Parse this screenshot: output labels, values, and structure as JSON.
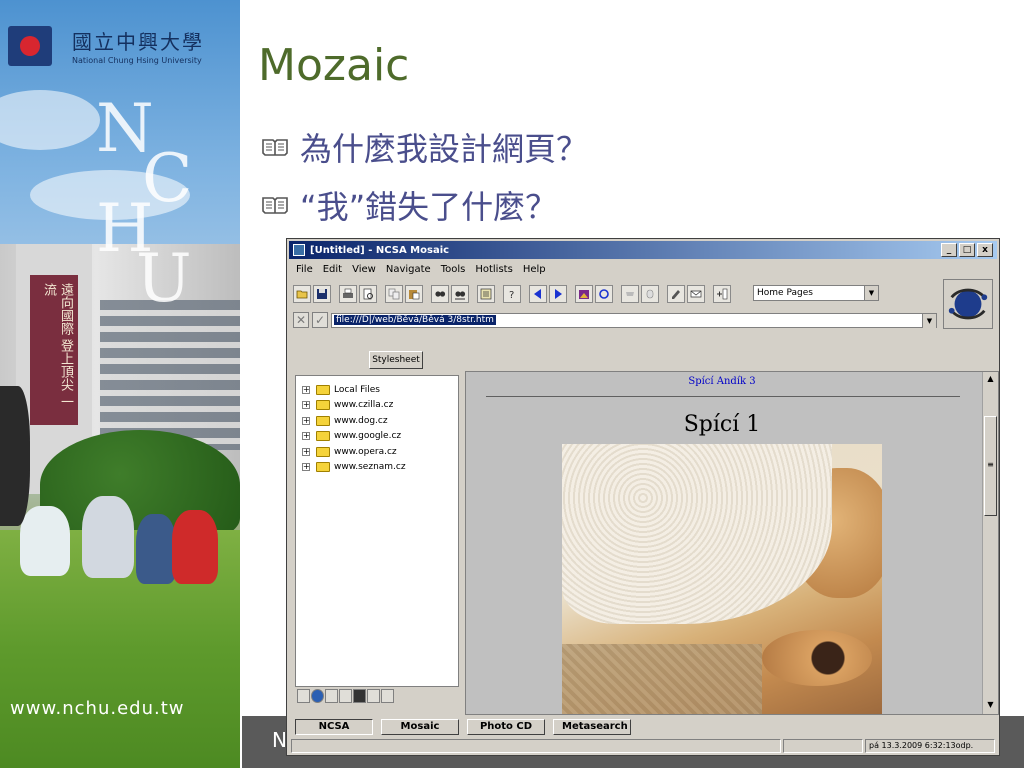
{
  "sidebar": {
    "logo_zh": "國立中興大學",
    "logo_en": "National Chung Hsing University",
    "monogram": [
      "N",
      "C",
      "H",
      "U"
    ],
    "banner_text": "遠向國際 登上頂尖 一流",
    "url": "www.nchu.edu.tw"
  },
  "slide": {
    "title": "Mozaic",
    "bullets": [
      {
        "icon": "book-icon",
        "text": "為什麼我設計網頁？"
      },
      {
        "icon": "book-icon",
        "text": "“我”錯失了什麼？"
      }
    ],
    "footer_letter": "N"
  },
  "browser": {
    "window_title": "[Untitled] - NCSA Mosaic",
    "title_buttons": [
      "_",
      "□",
      "x"
    ],
    "menu": [
      "File",
      "Edit",
      "View",
      "Navigate",
      "Tools",
      "Hotlists",
      "Help"
    ],
    "toolbar_icons": [
      "open-icon",
      "save-icon",
      "print-icon",
      "print-preview-icon",
      "copy-icon",
      "paste-icon",
      "find-icon",
      "find-next-icon",
      "document-icon",
      "help-icon",
      "back-icon",
      "forward-icon",
      "home-icon",
      "reload-icon",
      "stop-icon",
      "hand-icon",
      "annotate-icon",
      "mail-icon",
      "add-hotlist-icon"
    ],
    "hotlist_combo": "Home Pages",
    "url_value": "file:///D|/web/Běvá/Běvá 3/8str.htm",
    "stylesheet_button": "Stylesheet",
    "tree": [
      "Local Files",
      "www.czilla.cz",
      "www.dog.cz",
      "www.google.cz",
      "www.opera.cz",
      "www.seznam.cz"
    ],
    "doc": {
      "header": "Spící Andík 3",
      "heading": "Spící 1"
    },
    "bottom_tabs": [
      "NCSA",
      "Mosaic",
      "Photo CD",
      "Metasearch"
    ],
    "status": {
      "left": "",
      "right": "pá 13.3.2009 6:32:13odp."
    }
  },
  "colors": {
    "title_green": "#4e6b2b",
    "bullet_text": "#4a4e8c",
    "titlebar_start": "#0a246a",
    "titlebar_end": "#a6caf0",
    "link_blue": "#0000c8"
  }
}
